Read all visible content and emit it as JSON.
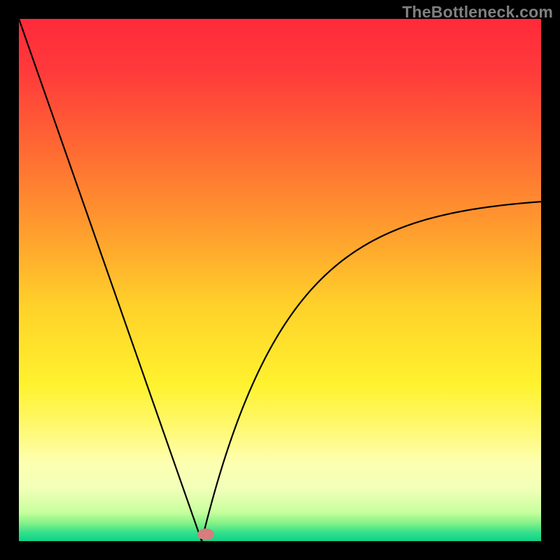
{
  "watermark": "TheBottleneck.com",
  "chart_data": {
    "type": "line",
    "title": "",
    "xlabel": "",
    "ylabel": "",
    "xlim": [
      0,
      100
    ],
    "ylim": [
      0,
      100
    ],
    "x0": 35,
    "left": {
      "x": [
        0,
        35
      ],
      "y": [
        100,
        0
      ]
    },
    "right": {
      "x": [
        35,
        100
      ],
      "y": [
        0,
        65
      ]
    },
    "marker": {
      "x": 35.8,
      "y": 1.3,
      "rx": 1.6,
      "ry": 1.1,
      "color": "#d67d7d"
    },
    "background_gradient": {
      "stops": [
        {
          "offset": 0.0,
          "color": "#ff2a3a"
        },
        {
          "offset": 0.1,
          "color": "#ff3a3b"
        },
        {
          "offset": 0.25,
          "color": "#ff6a33"
        },
        {
          "offset": 0.4,
          "color": "#ff9b2e"
        },
        {
          "offset": 0.55,
          "color": "#ffd12a"
        },
        {
          "offset": 0.7,
          "color": "#fff22e"
        },
        {
          "offset": 0.775,
          "color": "#fff86a"
        },
        {
          "offset": 0.85,
          "color": "#fdffb0"
        },
        {
          "offset": 0.9,
          "color": "#f1ffb8"
        },
        {
          "offset": 0.945,
          "color": "#c7ff9e"
        },
        {
          "offset": 0.965,
          "color": "#86f288"
        },
        {
          "offset": 0.985,
          "color": "#2fdf8a"
        },
        {
          "offset": 1.0,
          "color": "#0fd28b"
        }
      ]
    },
    "colors": {
      "frame": "#000000",
      "curve": "#000000",
      "marker": "#d67d7d"
    }
  }
}
